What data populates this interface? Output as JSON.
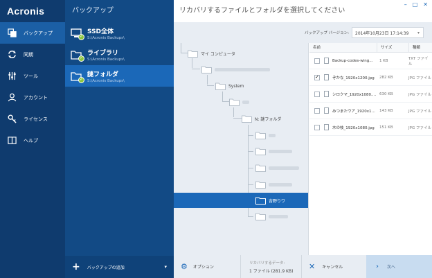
{
  "nav": {
    "logo": "Acronis",
    "items": [
      {
        "label": "バックアップ",
        "icon": "backup-icon",
        "active": true
      },
      {
        "label": "同期",
        "icon": "sync-icon",
        "active": false
      },
      {
        "label": "ツール",
        "icon": "tools-icon",
        "active": false
      },
      {
        "label": "アカウント",
        "icon": "account-icon",
        "active": false
      },
      {
        "label": "ライセンス",
        "icon": "key-icon",
        "active": false
      },
      {
        "label": "ヘルプ",
        "icon": "help-book-icon",
        "active": false
      }
    ]
  },
  "list": {
    "title": "バックアップ",
    "items": [
      {
        "name": "SSD全体",
        "path": "S:\\Acronis Backups\\"
      },
      {
        "name": "ライブラリ",
        "path": "S:\\Acronis Backups\\"
      },
      {
        "name": "謎フォルダ",
        "path": "S:\\Acronis Backups\\"
      }
    ],
    "add_label": "バックアップの追加"
  },
  "main": {
    "title": "リカバリするファイルとフォルダを選択してください",
    "window_controls": [
      "–",
      "□",
      "✕"
    ],
    "version_label": "バックアップ バージョン:",
    "version_value": "2014年10月23日 17:14:39"
  },
  "tree": {
    "nodes": [
      {
        "label": "マイ コンピュータ"
      },
      {
        "label": ""
      },
      {
        "label": "System"
      },
      {
        "label": ""
      },
      {
        "label": "N: 謎フォルダ"
      },
      {
        "label": "吉野りワ"
      }
    ]
  },
  "files": {
    "columns": [
      "名前",
      "サイズ",
      "種類"
    ],
    "rows": [
      {
        "name": "Backup-codes-wing...",
        "size": "1 KB",
        "type": "TXT ファイル",
        "checked": false
      },
      {
        "name": "ぞかな_1920x1200.jpg",
        "size": "282 KB",
        "type": "JPG ファイル",
        "checked": true
      },
      {
        "name": "シロクマ_1920x1080.j...",
        "size": "630 KB",
        "type": "JPG ファイル",
        "checked": false
      },
      {
        "name": "みつまたウア_1920x10...",
        "size": "143 KB",
        "type": "JPG ファイル",
        "checked": false
      },
      {
        "name": "木の枝_1920x1080.jpg",
        "size": "151 KB",
        "type": "JPG ファイル",
        "checked": false
      }
    ]
  },
  "footer": {
    "options_label": "オプション",
    "data_label": "リカバリするデータ:",
    "data_value": "1 ファイル (281.9 KB)",
    "cancel_label": "キャンセル",
    "next_label": "次へ"
  },
  "colors": {
    "nav_bg": "#0f3b6e",
    "list_bg": "#124a85",
    "accent": "#1b68b8",
    "check_green": "#8cc63f"
  }
}
